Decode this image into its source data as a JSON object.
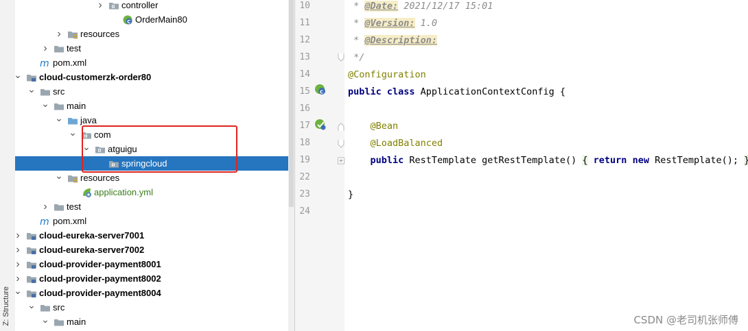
{
  "sidebar": {
    "structure_tab": "Z: Structure"
  },
  "tree": {
    "rows": [
      {
        "label": "controller",
        "bold": false,
        "color": "",
        "selected": false
      },
      {
        "label": "OrderMain80",
        "bold": false,
        "color": "",
        "selected": false
      },
      {
        "label": "resources",
        "bold": false,
        "color": "",
        "selected": false
      },
      {
        "label": "test",
        "bold": false,
        "color": "",
        "selected": false
      },
      {
        "label": "pom.xml",
        "bold": false,
        "color": "",
        "selected": false
      },
      {
        "label": "cloud-customerzk-order80",
        "bold": true,
        "color": "",
        "selected": false
      },
      {
        "label": "src",
        "bold": false,
        "color": "",
        "selected": false
      },
      {
        "label": "main",
        "bold": false,
        "color": "",
        "selected": false
      },
      {
        "label": "java",
        "bold": false,
        "color": "",
        "selected": false
      },
      {
        "label": "com",
        "bold": false,
        "color": "",
        "selected": false
      },
      {
        "label": "atguigu",
        "bold": false,
        "color": "",
        "selected": false
      },
      {
        "label": "springcloud",
        "bold": false,
        "color": "",
        "selected": true
      },
      {
        "label": "resources",
        "bold": false,
        "color": "",
        "selected": false
      },
      {
        "label": "application.yml",
        "bold": false,
        "color": "green",
        "selected": false
      },
      {
        "label": "test",
        "bold": false,
        "color": "",
        "selected": false
      },
      {
        "label": "pom.xml",
        "bold": false,
        "color": "",
        "selected": false
      },
      {
        "label": "cloud-eureka-server7001",
        "bold": true,
        "color": "",
        "selected": false
      },
      {
        "label": "cloud-eureka-server7002",
        "bold": true,
        "color": "",
        "selected": false
      },
      {
        "label": "cloud-provider-payment8001",
        "bold": true,
        "color": "",
        "selected": false
      },
      {
        "label": "cloud-provider-payment8002",
        "bold": true,
        "color": "",
        "selected": false
      },
      {
        "label": "cloud-provider-payment8004",
        "bold": true,
        "color": "",
        "selected": false
      },
      {
        "label": "src",
        "bold": false,
        "color": "",
        "selected": false
      },
      {
        "label": "main",
        "bold": false,
        "color": "",
        "selected": false
      }
    ]
  },
  "editor": {
    "line_numbers": [
      "10",
      "11",
      "12",
      "13",
      "14",
      "15",
      "16",
      "17",
      "18",
      "19",
      "22",
      "23",
      "24"
    ],
    "lines": [
      [
        {
          "t": " * ",
          "c": "cm"
        },
        {
          "t": "@Date:",
          "c": "tag"
        },
        {
          "t": " 2021/12/17 15:01",
          "c": "cm"
        }
      ],
      [
        {
          "t": " * ",
          "c": "cm"
        },
        {
          "t": "@Version:",
          "c": "tag"
        },
        {
          "t": " 1.0",
          "c": "cm"
        }
      ],
      [
        {
          "t": " * ",
          "c": "cm"
        },
        {
          "t": "@Description:",
          "c": "tag"
        }
      ],
      [
        {
          "t": " */",
          "c": "cm"
        }
      ],
      [
        {
          "t": "@Configuration",
          "c": "ann"
        }
      ],
      [
        {
          "t": "public class",
          "c": "kw"
        },
        {
          "t": " ApplicationContextConfig {",
          "c": ""
        }
      ],
      [],
      [
        {
          "t": "    @Bean",
          "c": "ann"
        }
      ],
      [
        {
          "t": "    @LoadBalanced",
          "c": "ann"
        }
      ],
      [
        {
          "t": "    ",
          "c": ""
        },
        {
          "t": "public",
          "c": "kw"
        },
        {
          "t": " RestTemplate getRestTemplate() ",
          "c": ""
        },
        {
          "t": "{",
          "c": "brace"
        },
        {
          "t": " ",
          "c": ""
        },
        {
          "t": "return new",
          "c": "kw"
        },
        {
          "t": " RestTemplate(); ",
          "c": ""
        },
        {
          "t": "}",
          "c": "brace"
        }
      ],
      [],
      [
        {
          "t": "}",
          "c": ""
        }
      ],
      []
    ]
  },
  "watermark": "CSDN @老司机张师傅",
  "colors": {
    "selection": "#2675bf",
    "annotation": "#808000",
    "keyword": "#000080",
    "highlight_box": "#e0241d"
  }
}
